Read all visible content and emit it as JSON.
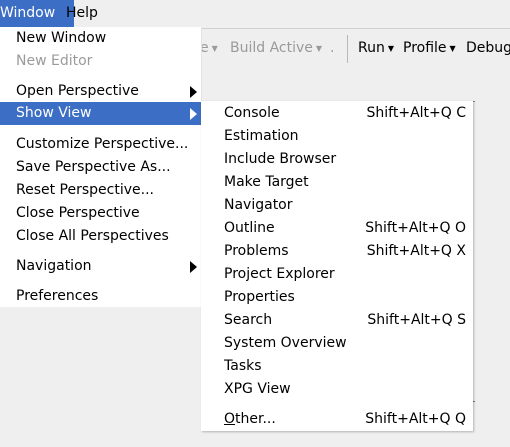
{
  "menubar": {
    "window": "Window",
    "help": "Help"
  },
  "toolbar": {
    "partial_left": "e",
    "build_active": "Build Active",
    "dot": ".",
    "run": "Run",
    "profile": "Profile",
    "debug": "Debug"
  },
  "window_menu": {
    "new_window": "New Window",
    "new_editor": "New Editor",
    "open_perspective": "Open Perspective",
    "show_view": "Show View",
    "customize_perspective": "Customize Perspective...",
    "save_perspective_as": "Save Perspective As...",
    "reset_perspective": "Reset Perspective...",
    "close_perspective": "Close Perspective",
    "close_all_perspectives": "Close All Perspectives",
    "navigation": "Navigation",
    "preferences": "Preferences"
  },
  "show_view_menu": {
    "items": [
      {
        "label": "Console",
        "shortcut": "Shift+Alt+Q C"
      },
      {
        "label": "Estimation",
        "shortcut": ""
      },
      {
        "label": "Include Browser",
        "shortcut": ""
      },
      {
        "label": "Make Target",
        "shortcut": ""
      },
      {
        "label": "Navigator",
        "shortcut": ""
      },
      {
        "label": "Outline",
        "shortcut": "Shift+Alt+Q O"
      },
      {
        "label": "Problems",
        "shortcut": "Shift+Alt+Q X"
      },
      {
        "label": "Project Explorer",
        "shortcut": ""
      },
      {
        "label": "Properties",
        "shortcut": ""
      },
      {
        "label": "Search",
        "shortcut": "Shift+Alt+Q S"
      },
      {
        "label": "System Overview",
        "shortcut": ""
      },
      {
        "label": "Tasks",
        "shortcut": ""
      },
      {
        "label": "XPG View",
        "shortcut": ""
      }
    ],
    "other": {
      "mnemonic": "O",
      "rest": "ther...",
      "shortcut": "Shift+Alt+Q Q"
    }
  },
  "icons": {
    "submenu_arrow": "triangle-right-icon",
    "dropdown": "caret-down-icon"
  },
  "colors": {
    "highlight": "#3b6ec4",
    "disabled_text": "#9a9a9a"
  }
}
